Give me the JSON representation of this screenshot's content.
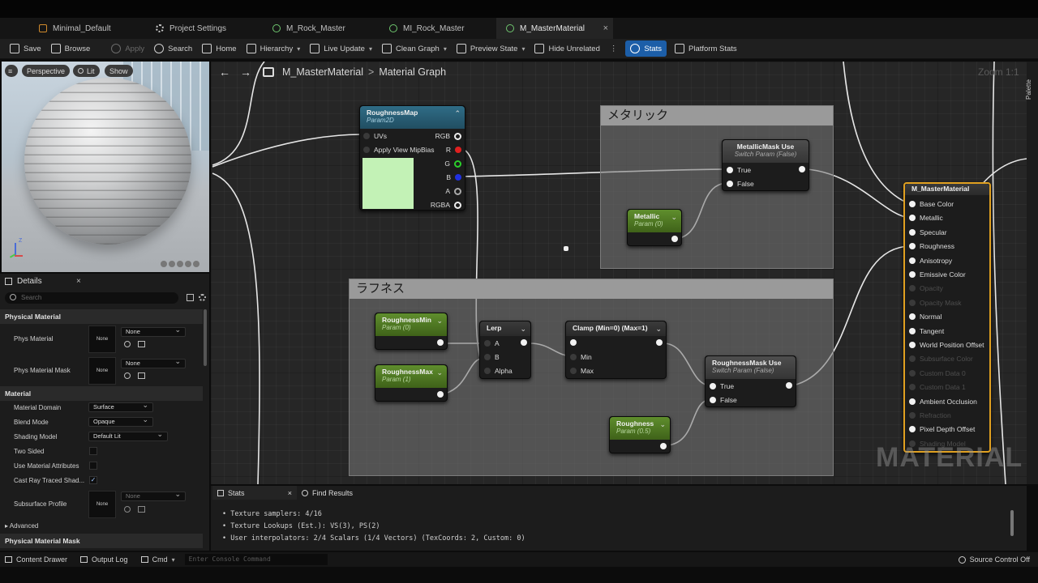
{
  "tabs": [
    {
      "label": "Minimal_Default",
      "icon": "level-icon"
    },
    {
      "label": "Project Settings",
      "icon": "gear-icon"
    },
    {
      "label": "M_Rock_Master",
      "icon": "material-icon"
    },
    {
      "label": "MI_Rock_Master",
      "icon": "material-instance-icon"
    },
    {
      "label": "M_MasterMaterial",
      "icon": "material-icon",
      "close": "×"
    }
  ],
  "toolbar": {
    "save": "Save",
    "browse": "Browse",
    "apply": "Apply",
    "search": "Search",
    "home": "Home",
    "hierarchy": "Hierarchy",
    "live_update": "Live Update",
    "clean_graph": "Clean Graph",
    "preview_state": "Preview State",
    "hide_unrelated": "Hide Unrelated",
    "more": "⋮",
    "stats": "Stats",
    "platform_stats": "Platform Stats"
  },
  "viewport": {
    "perspective": "Perspective",
    "lit": "Lit",
    "show": "Show",
    "axis_z": "Z"
  },
  "details": {
    "title": "Details",
    "close": "×",
    "search_placeholder": "Search",
    "sec_phys": "Physical Material",
    "phys_material": "Phys Material",
    "phys_material_mask": "Phys Material Mask",
    "none": "None",
    "sec_material": "Material",
    "material_domain": "Material Domain",
    "material_domain_val": "Surface",
    "blend_mode": "Blend Mode",
    "blend_mode_val": "Opaque",
    "shading_model": "Shading Model",
    "shading_model_val": "Default Lit",
    "two_sided": "Two Sided",
    "use_mat_attr": "Use Material Attributes",
    "cast_ray": "Cast Ray Traced Shad...",
    "cast_ray_checked": "✓",
    "subsurface_profile": "Subsurface Profile",
    "advanced": "Advanced",
    "sec_phys_mask": "Physical Material Mask"
  },
  "graph": {
    "breadcrumb_asset": "M_MasterMaterial",
    "breadcrumb_sep": ">",
    "breadcrumb_graph": "Material Graph",
    "zoom": "Zoom 1:1",
    "palette": "Palette",
    "watermark": "MATERIAL",
    "comments": {
      "metallic": "メタリック",
      "roughness": "ラフネス"
    },
    "nodes": {
      "roughness_map": {
        "title": "RoughnessMap",
        "sub": "Param2D",
        "uvs": "UVs",
        "mip": "Apply View MipBias",
        "rgb": "RGB",
        "r": "R",
        "g": "G",
        "b": "B",
        "a": "A",
        "rgba": "RGBA"
      },
      "metallic_mask": {
        "title": "MetallicMask Use",
        "sub": "Switch Param (False)",
        "true": "True",
        "false": "False"
      },
      "metallic": {
        "title": "Metallic",
        "sub": "Param (0)"
      },
      "roughness_min": {
        "title": "RoughnessMin",
        "sub": "Param (0)"
      },
      "roughness_max": {
        "title": "RoughnessMax",
        "sub": "Param (1)"
      },
      "lerp": {
        "title": "Lerp",
        "a": "A",
        "b": "B",
        "alpha": "Alpha"
      },
      "clamp": {
        "title": "Clamp (Min=0) (Max=1)",
        "min": "Min",
        "max": "Max"
      },
      "roughness_mask": {
        "title": "RoughnessMask Use",
        "sub": "Switch Param (False)",
        "true": "True",
        "false": "False"
      },
      "roughness": {
        "title": "Roughness",
        "sub": "Param (0.5)"
      },
      "master": {
        "title": "M_MasterMaterial",
        "pins": [
          {
            "label": "Base Color",
            "on": true
          },
          {
            "label": "Metallic",
            "on": true
          },
          {
            "label": "Specular",
            "on": true
          },
          {
            "label": "Roughness",
            "on": true
          },
          {
            "label": "Anisotropy",
            "on": true
          },
          {
            "label": "Emissive Color",
            "on": true
          },
          {
            "label": "Opacity",
            "on": false
          },
          {
            "label": "Opacity Mask",
            "on": false
          },
          {
            "label": "Normal",
            "on": true
          },
          {
            "label": "Tangent",
            "on": true
          },
          {
            "label": "World Position Offset",
            "on": true
          },
          {
            "label": "Subsurface Color",
            "on": false
          },
          {
            "label": "Custom Data 0",
            "on": false
          },
          {
            "label": "Custom Data 1",
            "on": false
          },
          {
            "label": "Ambient Occlusion",
            "on": true
          },
          {
            "label": "Refraction",
            "on": false
          },
          {
            "label": "Pixel Depth Offset",
            "on": true
          },
          {
            "label": "Shading Model",
            "on": false
          }
        ]
      }
    }
  },
  "bottom": {
    "stats_tab": "Stats",
    "close": "×",
    "find_tab": "Find Results",
    "lines": [
      "Texture samplers: 4/16",
      "Texture Lookups (Est.): VS(3), PS(2)",
      "User interpolators: 2/4 Scalars (1/4 Vectors) (TexCoords: 2, Custom: 0)"
    ]
  },
  "statusbar": {
    "content_drawer": "Content Drawer",
    "output_log": "Output Log",
    "cmd": "Cmd",
    "console_placeholder": "Enter Console Command",
    "source_control": "Source Control Off"
  }
}
